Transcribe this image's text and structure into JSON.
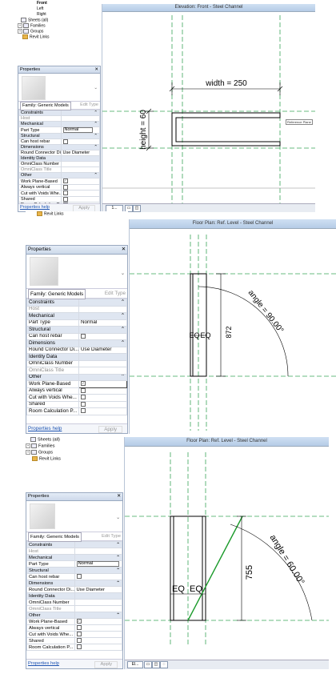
{
  "browser_top": {
    "items": [
      {
        "label": "Front",
        "bold": true
      },
      {
        "label": "Left"
      },
      {
        "label": "Right"
      },
      {
        "label": "Sheets (all)"
      },
      {
        "label": "Families"
      },
      {
        "label": "Groups"
      },
      {
        "label": "Revit Links"
      }
    ]
  },
  "browser_mid": {
    "items": [
      {
        "label": "Revit Links"
      }
    ]
  },
  "browser_bot": {
    "items": [
      {
        "label": "Sheets (all)"
      },
      {
        "label": "Families"
      },
      {
        "label": "Groups"
      },
      {
        "label": "Revit Links"
      }
    ]
  },
  "properties": {
    "title": "Properties",
    "close": "✕",
    "family_select": "Family: Generic Models",
    "edit_type": "Edit Type",
    "groups": {
      "constraints": "Constraints",
      "mechanical": "Mechanical",
      "structural": "Structural",
      "dimensions": "Dimensions",
      "identity": "Identity Data",
      "other": "Other"
    },
    "rows": {
      "host": "Host",
      "part_type": "Part Type",
      "part_type_value": "Normal",
      "can_host_rebar": "Can host rebar",
      "round_connector": "Round Connector Di...",
      "round_connector_value": "Use Diameter",
      "omniclass_number": "OmniClass Number",
      "omniclass_title": "OmniClass Title",
      "work_plane_based": "Work Plane-Based",
      "always_vertical": "Always vertical",
      "cut_with_voids": "Cut with Voids Whe...",
      "shared": "Shared",
      "room_calc": "Room Calculation P..."
    },
    "help_link": "Properties help",
    "apply": "Apply"
  },
  "view1": {
    "title": "Elevation: Front - Steel Channel",
    "width_label": "width = 250",
    "height_label": "height = 60",
    "ref_label": "Reference Plane",
    "status_btn": "1..."
  },
  "view2": {
    "title": "Floor Plan: Ref. Level - Steel Channel",
    "eq_left": "EQ",
    "eq_right": "EQ",
    "length_label": "872",
    "angle_label": "angle = 90.00°"
  },
  "view3": {
    "title": "Floor Plan: Ref. Level - Steel Channel",
    "eq_left": "EQ",
    "eq_right": "EQ",
    "length_label": "755",
    "angle_label": "angle = 60.00°",
    "status_btn": "El..."
  },
  "colors": {
    "refplane": "#3aa55a",
    "sweep_line": "#1a9a2a",
    "title_bar": "#cfe0f3"
  }
}
